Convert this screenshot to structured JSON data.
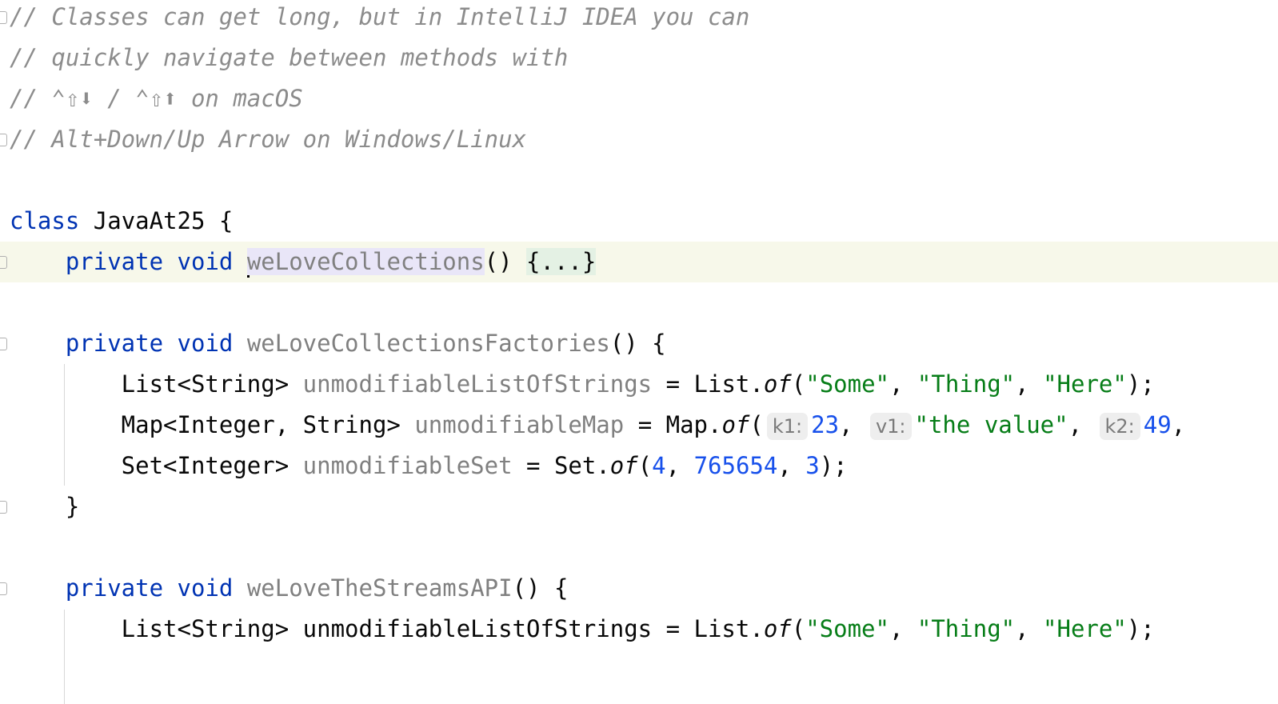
{
  "editor": {
    "lines": [
      {
        "tokens": [
          {
            "t": "// Classes can get long, but in IntelliJ IDEA you can",
            "k": "comment"
          }
        ],
        "fold": true
      },
      {
        "tokens": [
          {
            "t": "// quickly navigate between methods with",
            "k": "comment"
          }
        ]
      },
      {
        "tokens": [
          {
            "t": "// ⌃⇧⬇ / ⌃⇧⬆ on macOS",
            "k": "comment"
          }
        ]
      },
      {
        "tokens": [
          {
            "t": "// Alt+Down/Up Arrow on Windows/Linux",
            "k": "comment"
          }
        ],
        "fold": true
      },
      {
        "tokens": []
      },
      {
        "tokens": [
          {
            "t": "class",
            "k": "keyword"
          },
          {
            "t": " JavaAt25 {",
            "k": "plain"
          }
        ]
      },
      {
        "current": true,
        "fold": true,
        "tokens": [
          {
            "t": "    ",
            "k": "plain"
          },
          {
            "t": "private",
            "k": "keyword"
          },
          {
            "t": " ",
            "k": "plain"
          },
          {
            "t": "void",
            "k": "keyword"
          },
          {
            "t": " ",
            "k": "plain"
          },
          {
            "t": "",
            "k": "caret"
          },
          {
            "t": "weLoveCollections",
            "k": "selected"
          },
          {
            "t": "() ",
            "k": "plain"
          },
          {
            "t": "{...}",
            "k": "fold"
          }
        ]
      },
      {
        "tokens": []
      },
      {
        "fold": true,
        "tokens": [
          {
            "t": "    ",
            "k": "plain"
          },
          {
            "t": "private",
            "k": "keyword"
          },
          {
            "t": " ",
            "k": "plain"
          },
          {
            "t": "void",
            "k": "keyword"
          },
          {
            "t": " ",
            "k": "plain"
          },
          {
            "t": "weLoveCollectionsFactories",
            "k": "unused"
          },
          {
            "t": "() {",
            "k": "plain"
          }
        ]
      },
      {
        "tokens": [
          {
            "t": "        List<String> ",
            "k": "plain"
          },
          {
            "t": "unmodifiableListOfStrings",
            "k": "unused"
          },
          {
            "t": " = List.",
            "k": "plain"
          },
          {
            "t": "of",
            "k": "static"
          },
          {
            "t": "(",
            "k": "plain"
          },
          {
            "t": "\"Some\"",
            "k": "string"
          },
          {
            "t": ", ",
            "k": "plain"
          },
          {
            "t": "\"Thing\"",
            "k": "string"
          },
          {
            "t": ", ",
            "k": "plain"
          },
          {
            "t": "\"Here\"",
            "k": "string"
          },
          {
            "t": ");",
            "k": "plain"
          }
        ]
      },
      {
        "tokens": [
          {
            "t": "        Map<Integer, String> ",
            "k": "plain"
          },
          {
            "t": "unmodifiableMap",
            "k": "unused"
          },
          {
            "t": " = Map.",
            "k": "plain"
          },
          {
            "t": "of",
            "k": "static"
          },
          {
            "t": "(",
            "k": "plain"
          },
          {
            "t": "k1:",
            "k": "hint"
          },
          {
            "t": "23",
            "k": "number"
          },
          {
            "t": ", ",
            "k": "plain"
          },
          {
            "t": "v1:",
            "k": "hint"
          },
          {
            "t": "\"the value\"",
            "k": "string"
          },
          {
            "t": ", ",
            "k": "plain"
          },
          {
            "t": "k2:",
            "k": "hint"
          },
          {
            "t": "49",
            "k": "number"
          },
          {
            "t": ",",
            "k": "plain"
          }
        ]
      },
      {
        "tokens": [
          {
            "t": "        Set<Integer> ",
            "k": "plain"
          },
          {
            "t": "unmodifiableSet",
            "k": "unused"
          },
          {
            "t": " = Set.",
            "k": "plain"
          },
          {
            "t": "of",
            "k": "static"
          },
          {
            "t": "(",
            "k": "plain"
          },
          {
            "t": "4",
            "k": "number"
          },
          {
            "t": ", ",
            "k": "plain"
          },
          {
            "t": "765654",
            "k": "number"
          },
          {
            "t": ", ",
            "k": "plain"
          },
          {
            "t": "3",
            "k": "number"
          },
          {
            "t": ");",
            "k": "plain"
          }
        ]
      },
      {
        "fold": true,
        "tokens": [
          {
            "t": "    }",
            "k": "plain"
          }
        ]
      },
      {
        "tokens": []
      },
      {
        "fold": true,
        "tokens": [
          {
            "t": "    ",
            "k": "plain"
          },
          {
            "t": "private",
            "k": "keyword"
          },
          {
            "t": " ",
            "k": "plain"
          },
          {
            "t": "void",
            "k": "keyword"
          },
          {
            "t": " ",
            "k": "plain"
          },
          {
            "t": "weLoveTheStreamsAPI",
            "k": "unused"
          },
          {
            "t": "() {",
            "k": "plain"
          }
        ]
      },
      {
        "tokens": [
          {
            "t": "        List<String> unmodifiableListOfStrings = List.",
            "k": "plain"
          },
          {
            "t": "of",
            "k": "static"
          },
          {
            "t": "(",
            "k": "plain"
          },
          {
            "t": "\"Some\"",
            "k": "string"
          },
          {
            "t": ", ",
            "k": "plain"
          },
          {
            "t": "\"Thing\"",
            "k": "string"
          },
          {
            "t": ", ",
            "k": "plain"
          },
          {
            "t": "\"Here\"",
            "k": "string"
          },
          {
            "t": ");",
            "k": "plain"
          }
        ]
      },
      {
        "tokens": []
      }
    ]
  }
}
